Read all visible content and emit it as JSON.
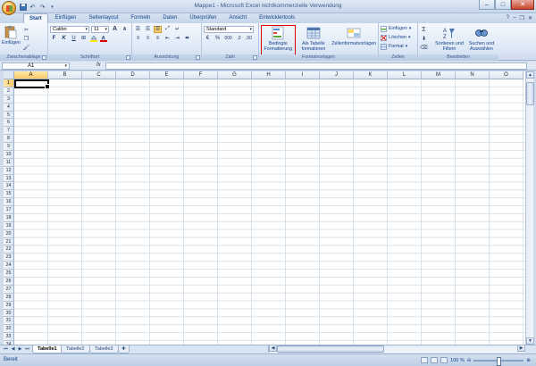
{
  "window": {
    "title": "Mappe1 - Microsoft Excel nichtkommerzielle Verwendung",
    "controls": {
      "minimize": "–",
      "maximize": "□",
      "close": "✕"
    }
  },
  "quick_access": {
    "save": "save-icon",
    "undo": "undo-icon",
    "redo": "redo-icon",
    "customize": "dropdown-icon"
  },
  "tabs": [
    {
      "label": "Start",
      "active": true
    },
    {
      "label": "Einfügen",
      "active": false
    },
    {
      "label": "Seitenlayout",
      "active": false
    },
    {
      "label": "Formeln",
      "active": false
    },
    {
      "label": "Daten",
      "active": false
    },
    {
      "label": "Überprüfen",
      "active": false
    },
    {
      "label": "Ansicht",
      "active": false
    },
    {
      "label": "Entwicklertools",
      "active": false
    }
  ],
  "ribbon": {
    "clipboard": {
      "label": "Zwischenablage",
      "paste": "Einfügen"
    },
    "font": {
      "label": "Schriftart",
      "font_name": "Calibri",
      "font_size": "11",
      "bold": "F",
      "italic": "K",
      "underline": "U",
      "grow": "A",
      "shrink": "A"
    },
    "alignment": {
      "label": "Ausrichtung"
    },
    "number": {
      "label": "Zahl",
      "format": "Standard",
      "percent": "%",
      "thousands": "000"
    },
    "styles": {
      "label": "Formatvorlagen",
      "conditional": "Bedingte Formatierung",
      "table": "Als Tabelle formatieren",
      "cell_styles": "Zellenformatvorlagen"
    },
    "cells": {
      "label": "Zellen",
      "insert": "Einfügen",
      "delete": "Löschen",
      "format": "Format"
    },
    "editing": {
      "label": "Bearbeiten",
      "sigma": "Σ",
      "sort": "Sortieren und Filtern",
      "find": "Suchen und Auswählen"
    }
  },
  "formula_bar": {
    "name_box": "A1",
    "fx": "fx",
    "value": ""
  },
  "columns": [
    "A",
    "B",
    "C",
    "D",
    "E",
    "F",
    "G",
    "H",
    "I",
    "J",
    "K",
    "L",
    "M",
    "N",
    "O"
  ],
  "rows": [
    "1",
    "2",
    "3",
    "4",
    "5",
    "6",
    "7",
    "8",
    "9",
    "10",
    "11",
    "12",
    "13",
    "14",
    "15",
    "16",
    "17",
    "18",
    "19",
    "20",
    "21",
    "22",
    "23",
    "24",
    "25",
    "26",
    "27",
    "28",
    "29",
    "30",
    "31",
    "32",
    "33",
    "34"
  ],
  "selected": {
    "col": "A",
    "row": "1"
  },
  "sheets": [
    {
      "label": "Tabelle1",
      "active": true
    },
    {
      "label": "Tabelle2",
      "active": false
    },
    {
      "label": "Tabelle3",
      "active": false
    }
  ],
  "status": {
    "text": "Bereit",
    "zoom": "100 %"
  }
}
